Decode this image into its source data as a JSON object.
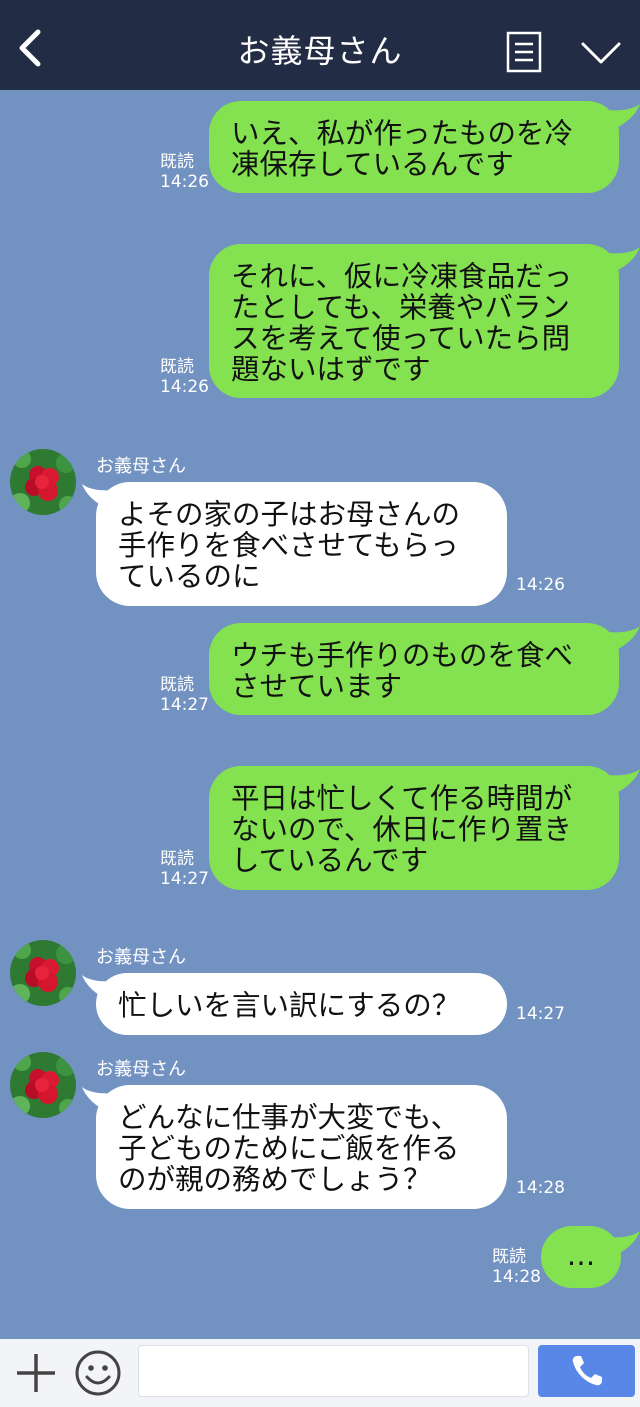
{
  "header": {
    "title": "お義母さん"
  },
  "contact": {
    "name": "お義母さん"
  },
  "messages": [
    {
      "from": "me",
      "text": "いえ、私が作ったものを冷\n凍保存しているんです",
      "read": "既読",
      "time": "14:26"
    },
    {
      "from": "me",
      "text": "それに、仮に冷凍食品だっ\nたとしても、栄養やバラン\nスを考えて使っていたら問\n題ないはずです",
      "read": "既読",
      "time": "14:26"
    },
    {
      "from": "them",
      "sender": "お義母さん",
      "text": "よその家の子はお母さんの\n手作りを食べさせてもらっ\nているのに",
      "time": "14:26"
    },
    {
      "from": "me",
      "text": "ウチも手作りのものを食べ\nさせています",
      "read": "既読",
      "time": "14:27"
    },
    {
      "from": "me",
      "text": "平日は忙しくて作る時間が\nないので、休日に作り置き\nしているんです",
      "read": "既読",
      "time": "14:27"
    },
    {
      "from": "them",
      "sender": "お義母さん",
      "text": "忙しいを言い訳にするの？",
      "time": "14:27"
    },
    {
      "from": "them",
      "sender": "お義母さん",
      "text": "どんなに仕事が大変でも、\n子どものためにご飯を作る\nのが親の務めでしょう？",
      "time": "14:28"
    },
    {
      "from": "me",
      "text": "…",
      "read": "既読",
      "time": "14:28"
    }
  ],
  "input": {
    "value": ""
  },
  "icons": {
    "back": "back-arrow-icon",
    "menu": "menu-icon",
    "collapse": "chevron-down-icon",
    "add": "plus-icon",
    "emoji": "smile-icon",
    "call": "phone-icon"
  },
  "colors": {
    "header": "#232c45",
    "background": "#7292c1",
    "my_bubble": "#84e251",
    "their_bubble": "#ffffff",
    "call_button": "#5987e8"
  }
}
